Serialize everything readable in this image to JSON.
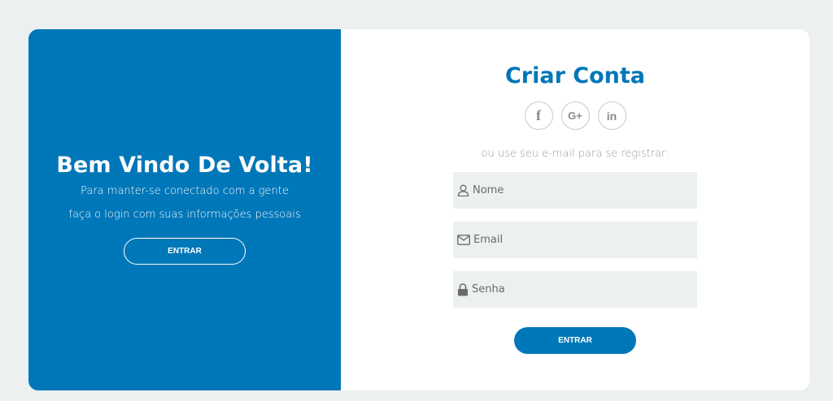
{
  "colors": {
    "accent": "#0077b8",
    "background": "#ecf0f1",
    "field_bg": "#ecf0f1"
  },
  "welcome": {
    "title": "Bem Vindo De Volta!",
    "line1": "Para manter-se conectado com a gente",
    "line2": "faça o login com suas informações pessoais",
    "button_label": "ENTRAR"
  },
  "signup": {
    "title": "Criar Conta",
    "social": [
      {
        "icon": "facebook-icon",
        "glyph": "f"
      },
      {
        "icon": "google-plus-icon",
        "glyph": "G+"
      },
      {
        "icon": "linkedin-icon",
        "glyph": "in"
      }
    ],
    "subtitle": "ou use seu e-mail para se registrar:",
    "fields": {
      "name": {
        "placeholder": "Nome",
        "icon": "user-icon"
      },
      "email": {
        "placeholder": "Email",
        "icon": "envelope-icon"
      },
      "password": {
        "placeholder": "Senha",
        "icon": "lock-icon"
      }
    },
    "button_label": "ENTRAR"
  }
}
